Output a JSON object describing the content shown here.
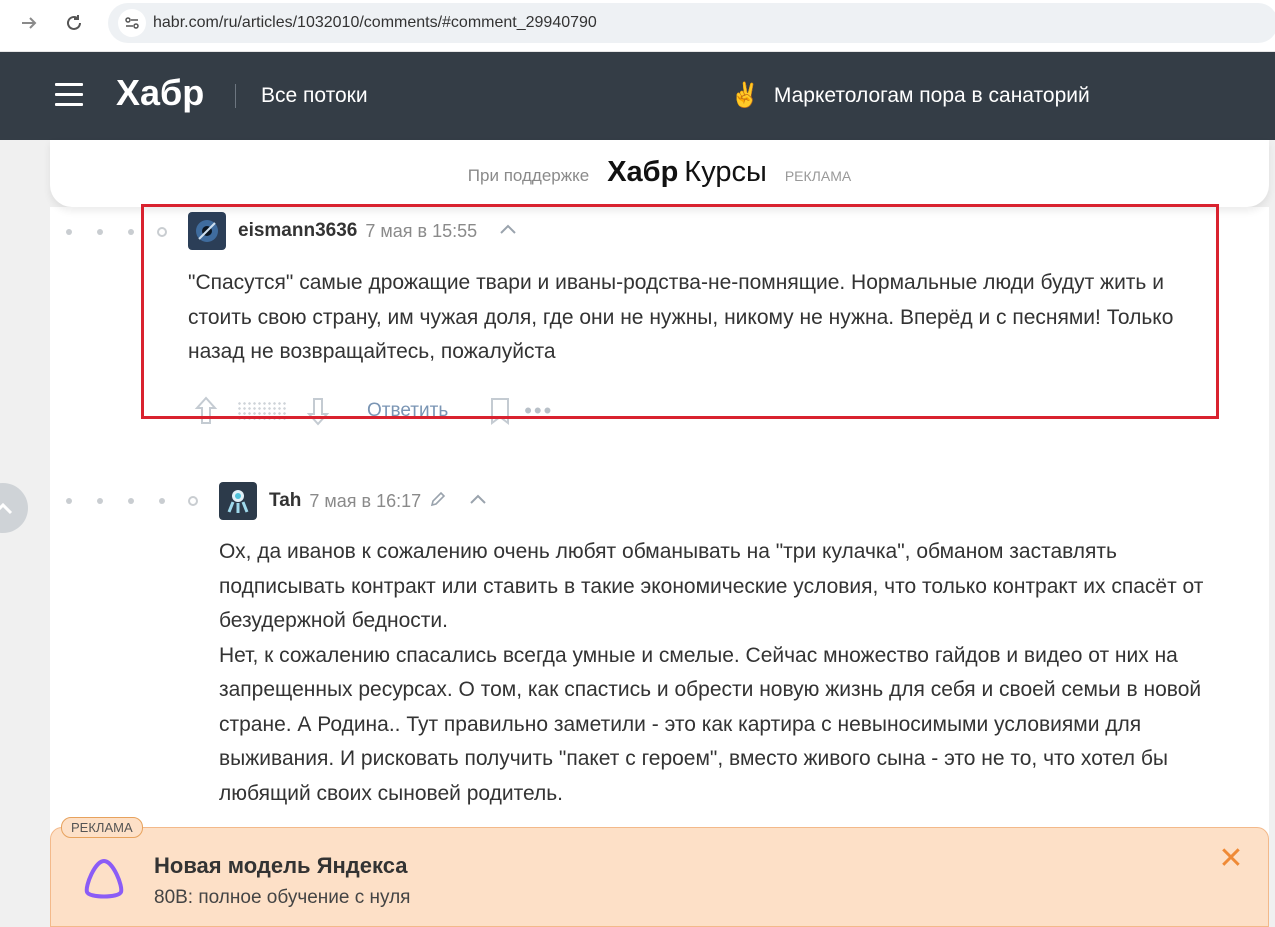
{
  "browser": {
    "url": "habr.com/ru/articles/1032010/comments/#comment_29940790"
  },
  "header": {
    "logo": "Хабр",
    "streams": "Все потоки",
    "promo_emoji": "✌",
    "promo_text": "Маркетологам пора в санаторий"
  },
  "sponsor": {
    "label": "При поддержке",
    "brand_bold": "Хабр",
    "brand_light": "Курсы",
    "ad": "РЕКЛАМА"
  },
  "comments": [
    {
      "username": "eismann3636",
      "date": "7 мая в 15:55",
      "text": "\"Спасутся\" самые дрожащие твари и иваны-родства-не-помнящие. Нормальные люди будут жить и стоить свою страну, им чужая доля, где они не нужны, никому не нужна. Вперёд и с песнями! Только назад не возвращайтесь, пожалуйста",
      "reply": "Ответить"
    },
    {
      "username": "Tah",
      "date": "7 мая в 16:17",
      "paragraphs": [
        "Ох, да иванов к сожалению очень любят обманывать на \"три кулачка\", обманом заставлять подписывать контракт или ставить в такие экономические условия, что только контракт их спасёт от безудержной бедности.",
        "Нет, к сожалению спасались всегда умные и смелые. Сейчас множество гайдов и видео от них на запрещенных ресурсах. О том, как спастись и обрести новую жизнь для себя и своей семьи в новой стране. А Родина.. Тут правильно заметили - это как картира с невыносимыми условиями для выживания. И рисковать получить \"пакет с героем\", вместо живого сына - это не то, что хотел бы любящий своих сыновей родитель."
      ]
    }
  ],
  "ad_banner": {
    "tag": "РЕКЛАМА",
    "title": "Новая модель Яндекса",
    "subtitle": "80B: полное обучение с нуля",
    "close": "✕"
  },
  "colors": {
    "header_bg": "#343d46",
    "highlight": "#d9222f",
    "ad_bg": "#fde0c7",
    "ad_accent": "#ef8a36"
  }
}
